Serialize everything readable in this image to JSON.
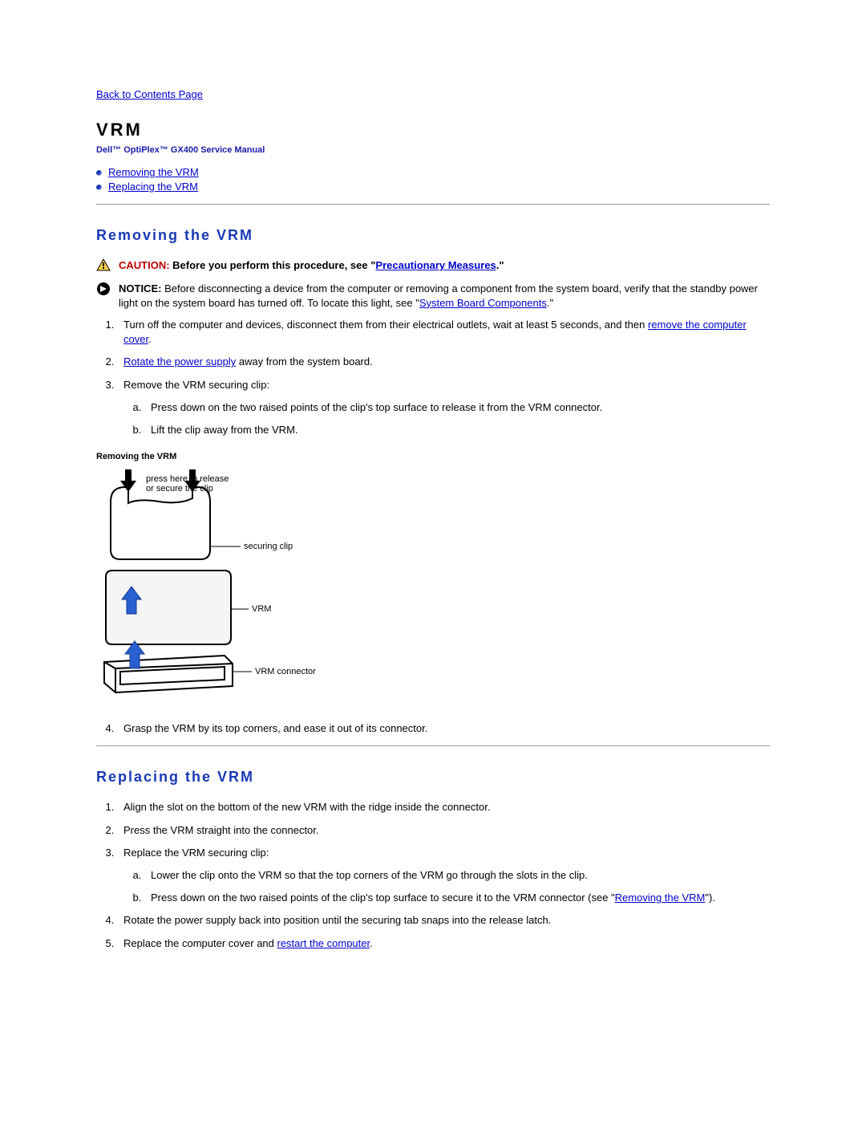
{
  "nav": {
    "back": "Back to Contents Page"
  },
  "title": "VRM",
  "subtitle": "Dell™ OptiPlex™ GX400 Service Manual",
  "toc": {
    "removing": "Removing the VRM",
    "replacing": "Replacing the VRM"
  },
  "removing": {
    "heading": "Removing the VRM",
    "caution": {
      "label": "CAUTION: ",
      "prefix": "Before you perform this procedure, see \"",
      "link": "Precautionary Measures",
      "suffix": ".\""
    },
    "notice": {
      "label": "NOTICE: ",
      "prefix": "Before disconnecting a device from the computer or removing a component from the system board, verify that the standby power light on the system board has turned off. To locate this light, see \"",
      "link": "System Board Components",
      "suffix": ".\""
    },
    "steps": {
      "s1_prefix": "Turn off the computer and devices, disconnect them from their electrical outlets, wait at least 5 seconds, and then ",
      "s1_link": "remove the computer cover",
      "s1_suffix": ".",
      "s2_link": "Rotate the power supply",
      "s2_suffix": " away from the system board.",
      "s3": "Remove the VRM securing clip:",
      "s3a": "Press down on the two raised points of the clip's top surface to release it from the VRM connector.",
      "s3b": "Lift the clip away from the VRM.",
      "s4": "Grasp the VRM by its top corners, and ease it out of its connector."
    },
    "figure": {
      "caption": "Removing the VRM",
      "labels": {
        "press": "press here to release\nor secure the clip",
        "clip": "securing clip",
        "vrm": "VRM",
        "connector": "VRM connector"
      }
    }
  },
  "replacing": {
    "heading": "Replacing the VRM",
    "steps": {
      "s1": "Align the slot on the bottom of the new VRM with the ridge inside the connector.",
      "s2": "Press the VRM straight into the connector.",
      "s3": "Replace the VRM securing clip:",
      "s3a": "Lower the clip onto the VRM so that the top corners of the VRM go through the slots in the clip.",
      "s3b_prefix": "Press down on the two raised points of the clip's top surface to secure it to the VRM connector (see \"",
      "s3b_link": "Removing the VRM",
      "s3b_suffix": "\").",
      "s4": "Rotate the power supply back into position until the securing tab snaps into the release latch.",
      "s5_prefix": "Replace the computer cover and ",
      "s5_link": "restart the computer",
      "s5_suffix": "."
    }
  }
}
